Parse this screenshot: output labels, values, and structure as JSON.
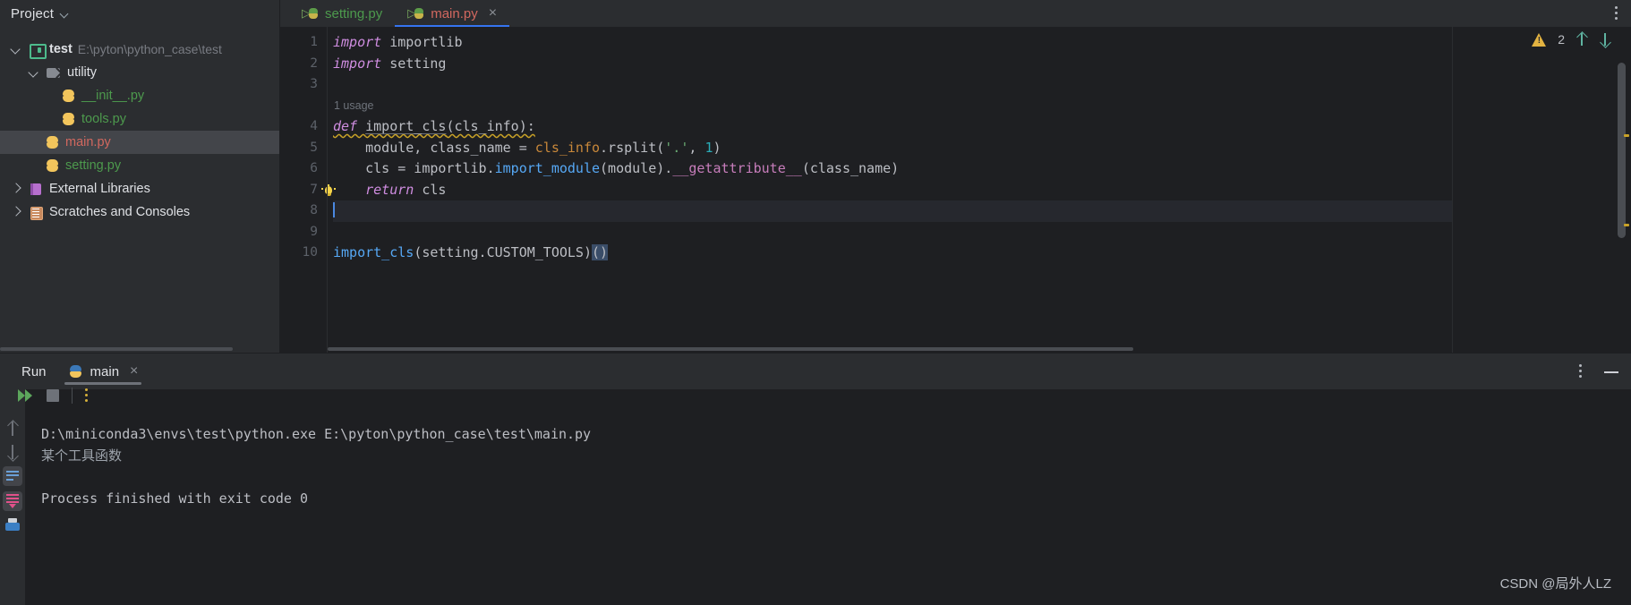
{
  "sidebar": {
    "title": "Project",
    "chevron_icon": "chevron-down-icon",
    "items": [
      {
        "label": "test",
        "path": "E:\\pyton\\python_case\\test",
        "icon": "module-folder-icon",
        "twisty": "open",
        "indent": 0,
        "style": "root",
        "selected": false
      },
      {
        "label": "utility",
        "path": "",
        "icon": "source-folder-icon",
        "twisty": "open",
        "indent": 1,
        "style": "plain",
        "selected": false
      },
      {
        "label": "__init__.py",
        "path": "",
        "icon": "python-file-icon",
        "twisty": "none",
        "indent": 2,
        "style": "green",
        "selected": false
      },
      {
        "label": "tools.py",
        "path": "",
        "icon": "python-file-icon",
        "twisty": "none",
        "indent": 2,
        "style": "green",
        "selected": false
      },
      {
        "label": "main.py",
        "path": "",
        "icon": "python-file-icon",
        "twisty": "none",
        "indent": 1,
        "style": "red",
        "selected": true
      },
      {
        "label": "setting.py",
        "path": "",
        "icon": "python-file-icon",
        "twisty": "none",
        "indent": 1,
        "style": "green",
        "selected": false
      },
      {
        "label": "External Libraries",
        "path": "",
        "icon": "library-book-icon",
        "twisty": "closed",
        "indent": 0,
        "style": "plain",
        "selected": false
      },
      {
        "label": "Scratches and Consoles",
        "path": "",
        "icon": "scratches-icon",
        "twisty": "closed",
        "indent": 0,
        "style": "plain",
        "selected": false
      }
    ]
  },
  "editor": {
    "tabs": [
      {
        "label": "setting.py",
        "icon": "python-test-file-icon",
        "active": false,
        "closable": false,
        "color": "green"
      },
      {
        "label": "main.py",
        "icon": "python-test-file-icon",
        "active": true,
        "closable": true,
        "color": "red"
      }
    ],
    "tab_close_glyph": "×",
    "options_icon": "more-options-kebab-icon",
    "inspection": {
      "warning_icon": "warning-triangle-icon",
      "warning_count": "2",
      "prev_icon": "arrow-up-icon",
      "next_icon": "arrow-down-icon"
    },
    "usage_hint": "1 usage",
    "line_numbers": [
      "1",
      "2",
      "3",
      "4",
      "5",
      "6",
      "7",
      "8",
      "9",
      "10"
    ],
    "code_lines": [
      "import importlib",
      "import setting",
      "",
      "def import_cls(cls_info):",
      "    module, class_name = cls_info.rsplit('.', 1)",
      "    cls = importlib.import_module(module).__getattribute__(class_name)",
      "    return cls",
      "",
      "",
      "import_cls(setting.CUSTOM_TOOLS)()"
    ],
    "gutter_bulb_icon": "lightbulb-intention-icon",
    "caret_line": "8"
  },
  "run_panel": {
    "title": "Run",
    "tab_label": "main",
    "tab_icon": "python-run-config-icon",
    "tab_close_glyph": "×",
    "options_icon": "more-options-kebab-icon",
    "minimize_icon": "minimize-icon",
    "toolbar": {
      "rerun_icon": "rerun-icon",
      "stop_icon": "stop-icon",
      "more_icon": "more-options-kebab-icon"
    },
    "rail": {
      "up_icon": "scroll-up-icon",
      "down_icon": "scroll-down-icon",
      "soft_wrap_icon": "soft-wrap-icon",
      "scroll-to-end_icon": "scroll-to-end-icon",
      "print_icon": "print-icon"
    },
    "console_lines": [
      {
        "text": "D:\\miniconda3\\envs\\test\\python.exe E:\\pyton\\python_case\\test\\main.py",
        "dim": false
      },
      {
        "text": "某个工具函数",
        "dim": true
      },
      {
        "text": "",
        "dim": false
      },
      {
        "text": "Process finished with exit code 0",
        "dim": false
      }
    ]
  },
  "watermark": "CSDN @局外人LZ",
  "colors": {
    "background": "#2b2d30",
    "editor_background": "#1e1f22",
    "accent_tab_underline": "#3574f0",
    "selection": "#43454a",
    "keyword": "#cf8de0",
    "string": "#6aab73",
    "number": "#2aacb8",
    "function_call": "#56a8f5",
    "magic_method": "#c77dbb",
    "field": "#c9883a",
    "warning": "#e3b341"
  }
}
